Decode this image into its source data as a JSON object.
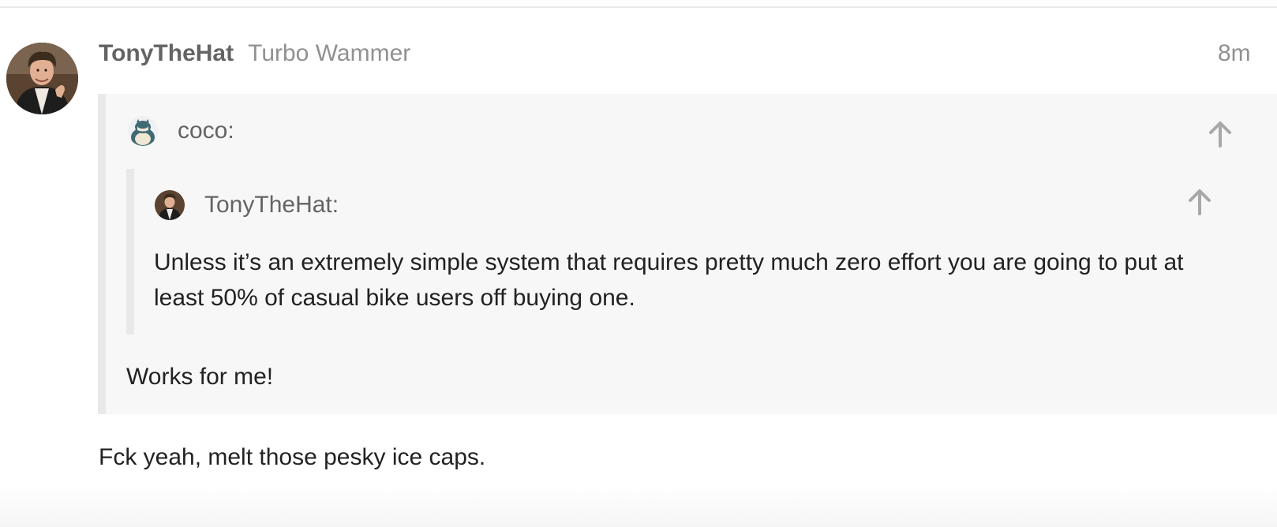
{
  "post": {
    "author": "TonyTheHat",
    "user_title": "Turbo Wammer",
    "date": "8m",
    "avatar_icon": "user-avatar-photo",
    "quote": {
      "author": "coco:",
      "avatar_icon": "snorlax-avatar",
      "expand_icon": "arrow-up-icon",
      "nested_quote": {
        "author": "TonyTheHat:",
        "avatar_icon": "user-avatar-photo",
        "expand_icon": "arrow-up-icon",
        "text": "Unless it’s an extremely simple system that requires pretty much zero effort you are going to put at least 50% of casual bike users off buying one."
      },
      "reply": "Works for me!"
    },
    "body": "Fck yeah, melt those pesky ice caps."
  },
  "colors": {
    "username": "#646464",
    "meta": "#919191",
    "quote_background": "#f7f7f7",
    "quote_border": "#e9e9e9",
    "text": "#222222"
  }
}
